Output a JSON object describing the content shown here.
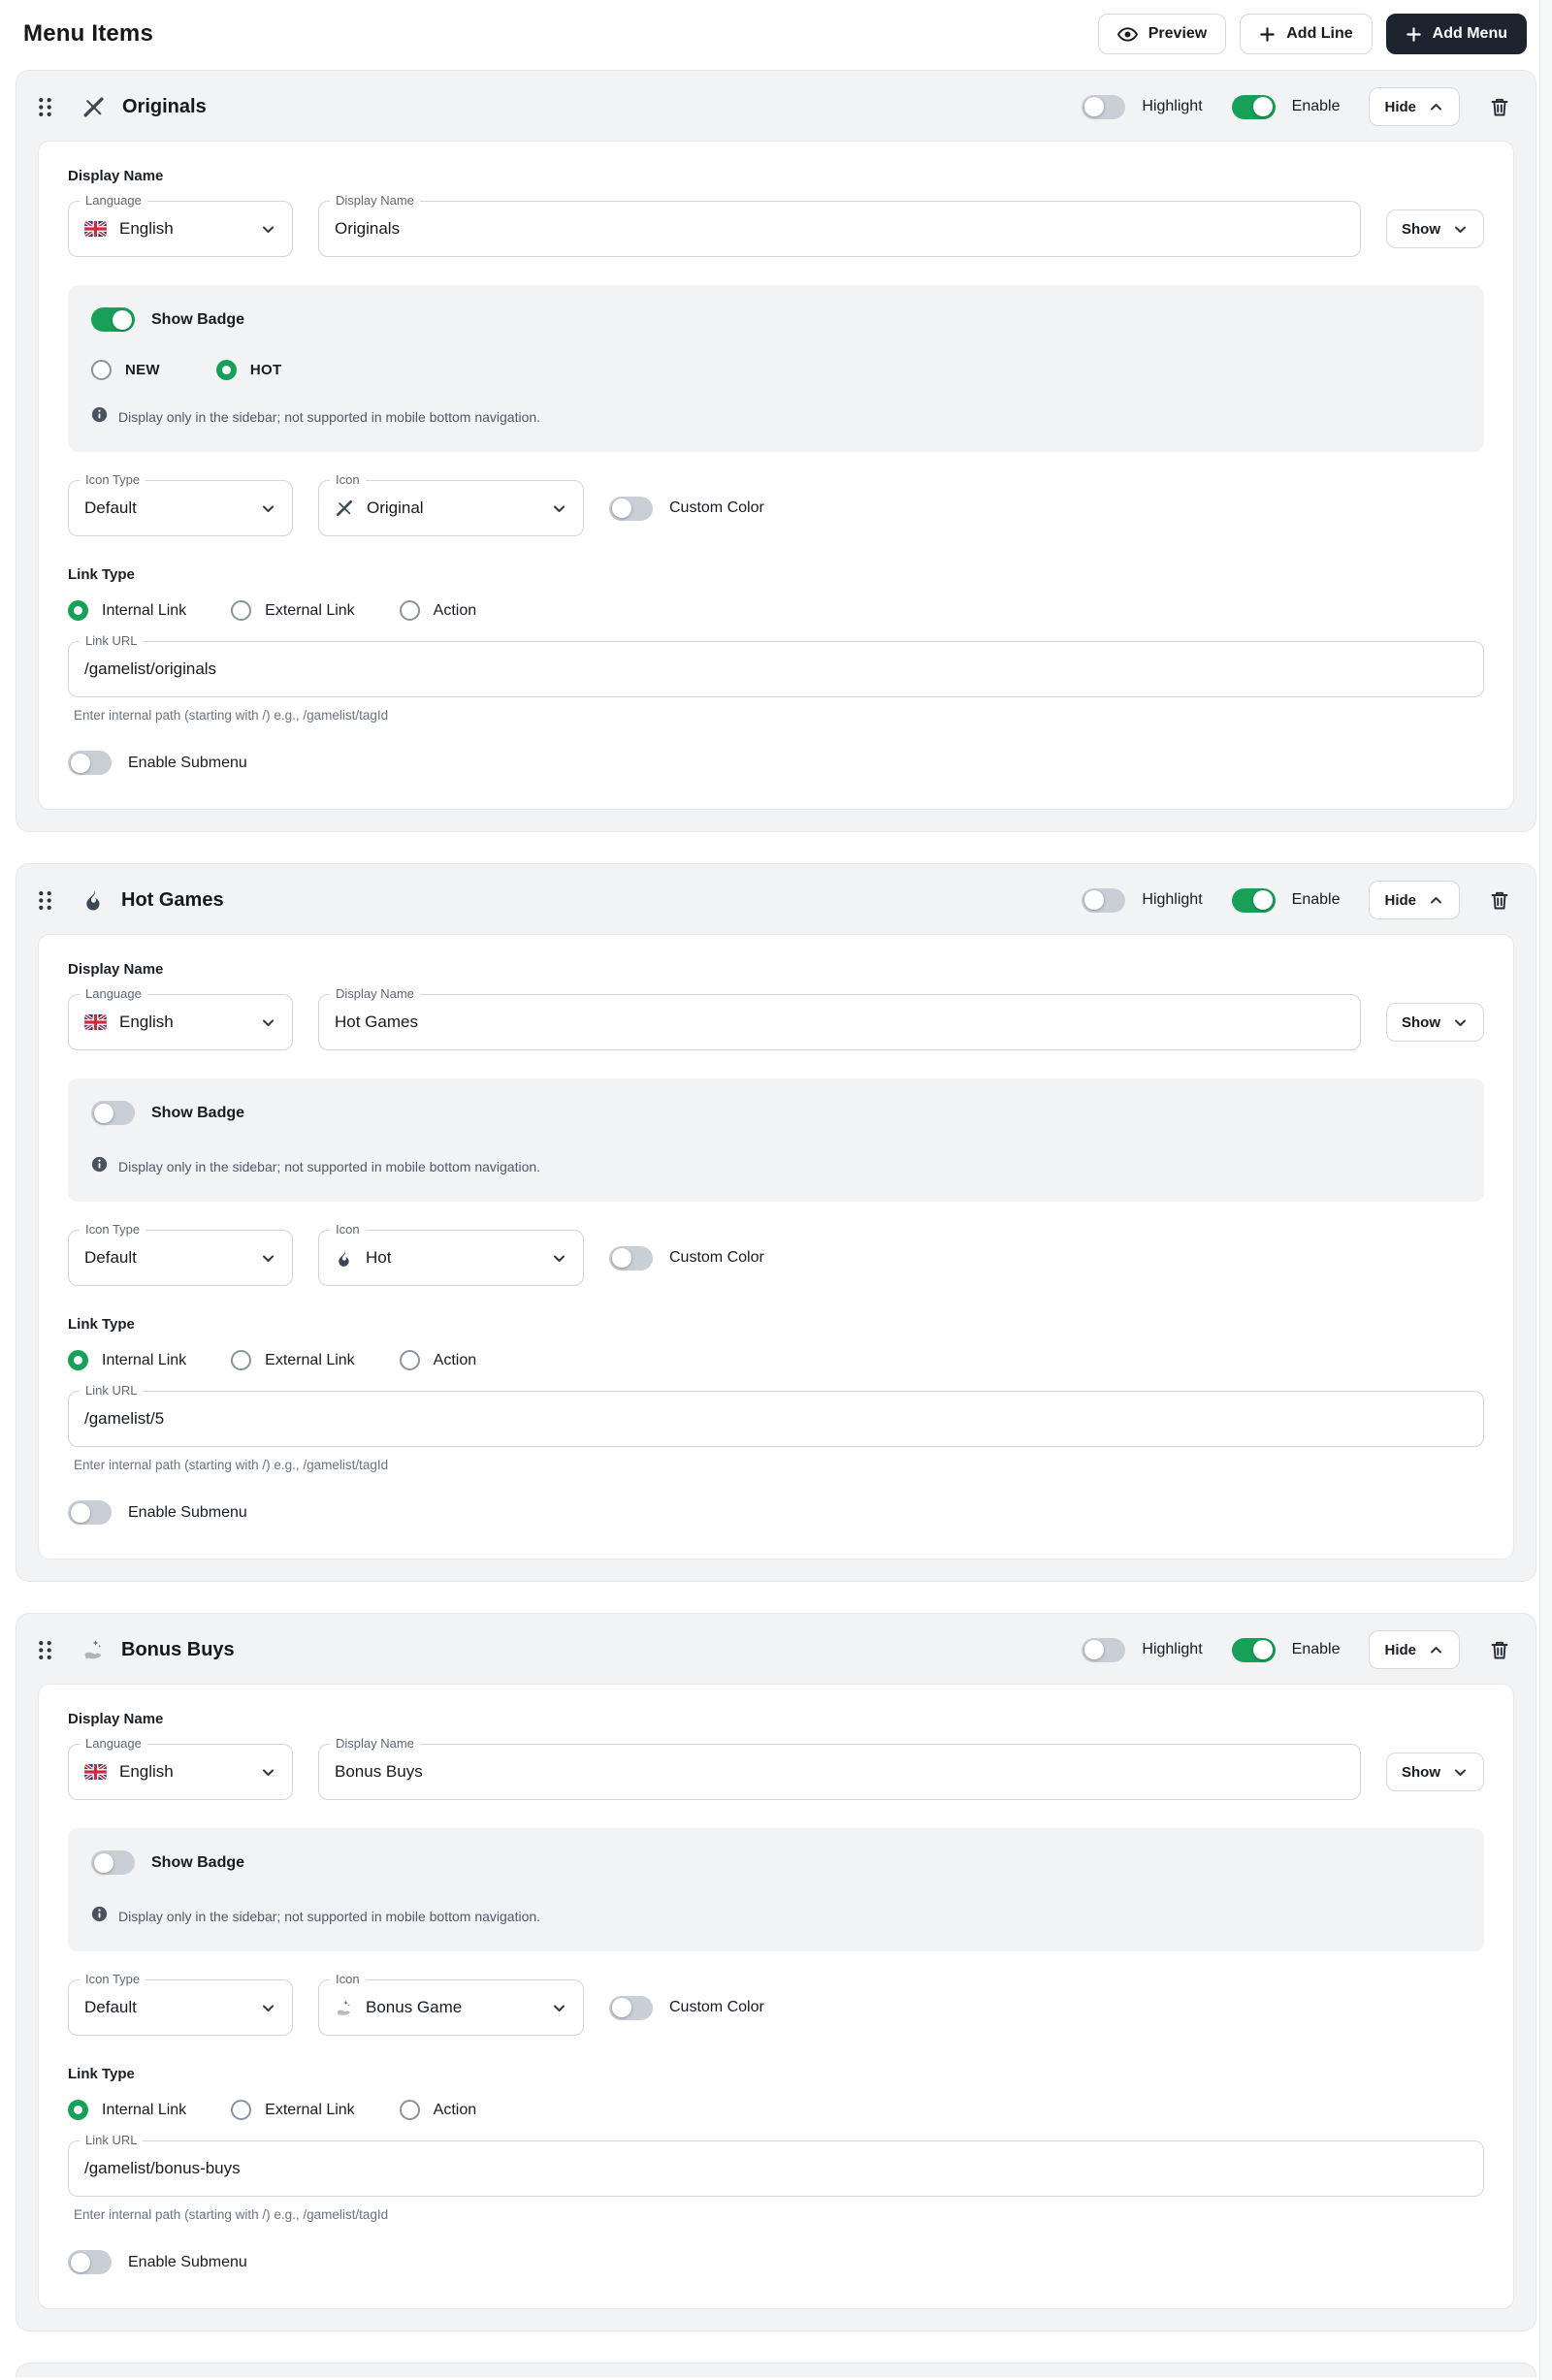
{
  "page": {
    "title": "Menu Items"
  },
  "toolbar": {
    "preview_label": "Preview",
    "add_line_label": "Add Line",
    "add_menu_label": "Add Menu"
  },
  "labels": {
    "display_name_section": "Display Name",
    "language": "Language",
    "display_name": "Display Name",
    "show": "Show",
    "hide": "Hide",
    "highlight": "Highlight",
    "enable": "Enable",
    "show_badge": "Show Badge",
    "badge_new": "NEW",
    "badge_hot": "HOT",
    "badge_info": "Display only in the sidebar; not supported in mobile bottom navigation.",
    "icon_type": "Icon Type",
    "icon": "Icon",
    "custom_color": "Custom Color",
    "link_type": "Link Type",
    "internal_link": "Internal Link",
    "external_link": "External Link",
    "action": "Action",
    "link_url": "Link URL",
    "link_url_helper": "Enter internal path (starting with /) e.g., /gamelist/tagId",
    "enable_submenu": "Enable Submenu"
  },
  "shared_values": {
    "language": "English",
    "icon_type": "Default"
  },
  "cards": [
    {
      "title": "Originals",
      "display_name": "Originals",
      "icon_name": "Original",
      "link_url": "/gamelist/originals",
      "show_badge": "on",
      "badge_selected": "HOT",
      "highlight": "off",
      "enable": "on",
      "link_type_selected": "Internal Link",
      "header_icon": "originals-cross-icon"
    },
    {
      "title": "Hot Games",
      "display_name": "Hot Games",
      "icon_name": "Hot",
      "link_url": "/gamelist/5",
      "show_badge": "off",
      "highlight": "off",
      "enable": "on",
      "link_type_selected": "Internal Link",
      "header_icon": "flame-icon"
    },
    {
      "title": "Bonus Buys",
      "display_name": "Bonus Buys",
      "icon_name": "Bonus Game",
      "link_url": "/gamelist/bonus-buys",
      "show_badge": "off",
      "highlight": "off",
      "enable": "on",
      "link_type_selected": "Internal Link",
      "header_icon": "bonus-hand-icon"
    }
  ],
  "icons": {
    "preview": "eye-icon",
    "add": "plus-icon",
    "drag": "drag-handle-icon",
    "delete": "trash-icon",
    "info": "info-icon",
    "chevron_down": "chevron-down-icon",
    "chevron_up": "chevron-up-icon",
    "language_flag": "uk-flag-icon"
  },
  "colors": {
    "accent_green": "#18a058",
    "dark_button": "#1d242f",
    "card_background": "#f2f3f5"
  }
}
